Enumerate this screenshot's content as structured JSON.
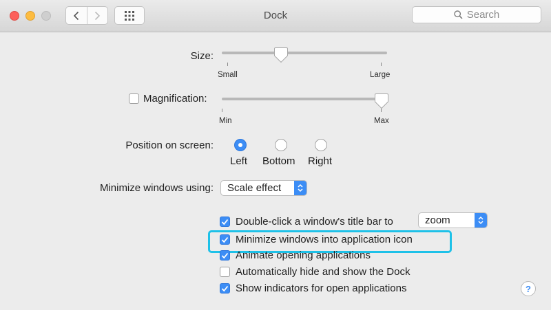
{
  "window": {
    "title": "Dock",
    "search_placeholder": "Search"
  },
  "size": {
    "label": "Size:",
    "min_label": "Small",
    "max_label": "Large",
    "value_fraction": 0.35
  },
  "magnification": {
    "label": "Magnification:",
    "checked": false,
    "min_label": "Min",
    "max_label": "Max",
    "value_fraction": 1.0
  },
  "position": {
    "label": "Position on screen:",
    "options": [
      "Left",
      "Bottom",
      "Right"
    ],
    "selected": "Left"
  },
  "minimize": {
    "label": "Minimize windows using:",
    "value": "Scale effect"
  },
  "options": {
    "double_click_label": "Double-click a window's title bar to",
    "double_click_value": "zoom",
    "minimize_into_icon": "Minimize windows into application icon",
    "animate": "Animate opening applications",
    "autohide": "Automatically hide and show the Dock",
    "indicators": "Show indicators for open applications"
  },
  "help": {
    "label": "?"
  },
  "colors": {
    "accent": "#3c8df5",
    "highlight": "#1ec1e8"
  }
}
